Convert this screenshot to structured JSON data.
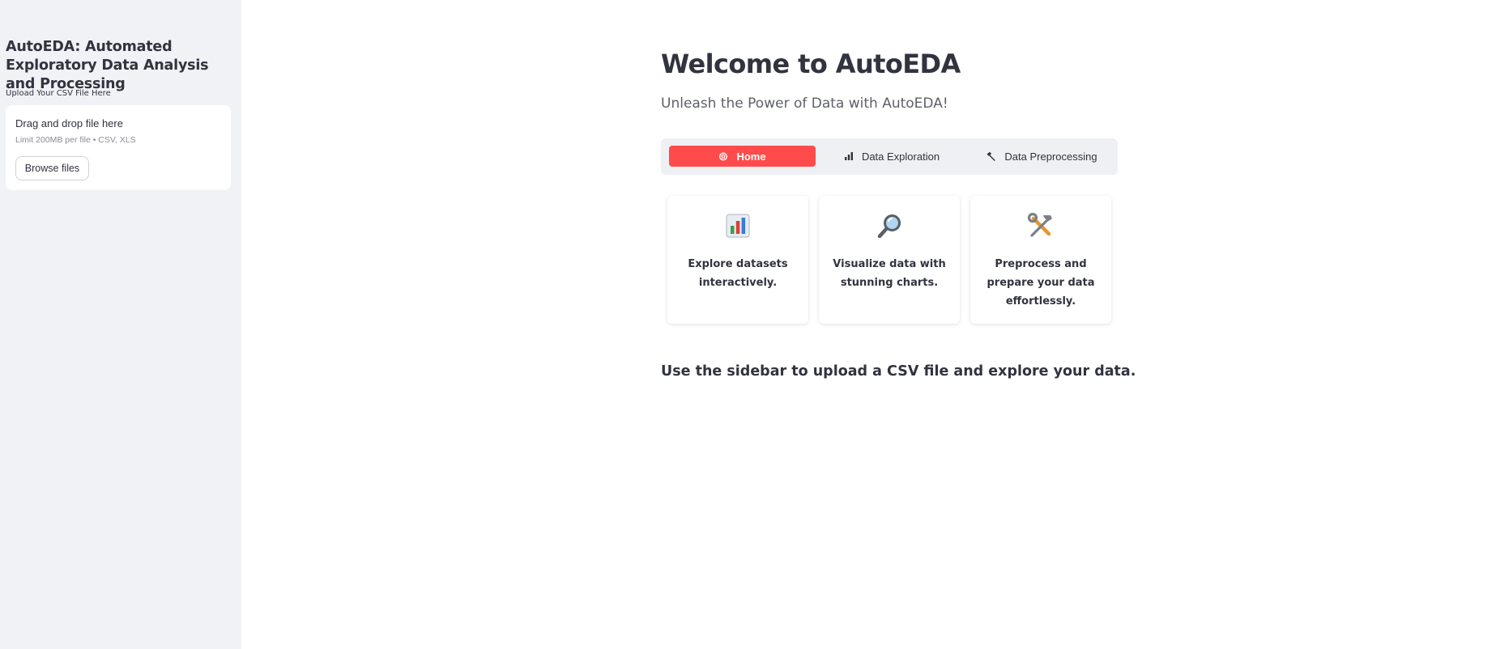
{
  "sidebar": {
    "title": "AutoEDA: Automated Exploratory Data Analysis and Processing",
    "upload_label": "Upload Your CSV File Here",
    "dropzone": {
      "title": "Drag and drop file here",
      "limit": "Limit 200MB per file • CSV, XLS",
      "browse_label": "Browse files"
    }
  },
  "main": {
    "title": "Welcome to AutoEDA",
    "subtitle": "Unleash the Power of Data with AutoEDA!",
    "tabs": [
      {
        "label": "Home",
        "icon": "home-icon",
        "active": true
      },
      {
        "label": "Data Exploration",
        "icon": "bar-chart-icon",
        "active": false
      },
      {
        "label": "Data Preprocessing",
        "icon": "hammer-icon",
        "active": false
      }
    ],
    "cards": [
      {
        "icon": "bar-chart-emoji-icon",
        "text": "Explore datasets interactively."
      },
      {
        "icon": "magnifier-emoji-icon",
        "text": "Visualize data with stunning charts."
      },
      {
        "icon": "hammer-wrench-emoji-icon",
        "text": "Preprocess and prepare your data effortlessly."
      }
    ],
    "hint": "Use the sidebar to upload a CSV file and explore your data."
  },
  "colors": {
    "accent": "#ff4b4b",
    "sidebar_bg": "#f0f2f6",
    "text": "#31333f"
  }
}
